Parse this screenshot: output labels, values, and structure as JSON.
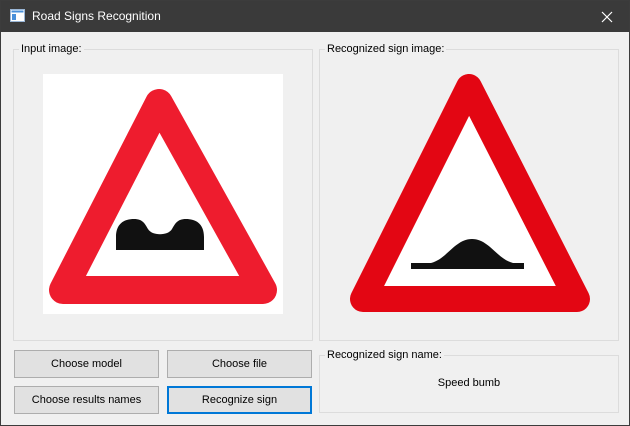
{
  "window": {
    "title": "Road Signs Recognition",
    "titlebar_color": "#3a3a3a",
    "app_icon": "window-app-icon",
    "close_icon": "close-icon"
  },
  "input_panel": {
    "label": "Input image:",
    "image": "warning-triangle-speed-bumps-sign"
  },
  "recognized_panel": {
    "label": "Recognized sign image:",
    "image": "warning-triangle-speed-bump-sign"
  },
  "buttons": {
    "choose_model": "Choose model",
    "choose_file": "Choose file",
    "choose_results_names": "Choose results names",
    "recognize_sign": "Recognize sign",
    "focus_color": "#0078d7"
  },
  "result_panel": {
    "label": "Recognized sign name:",
    "value": "Speed bumb"
  },
  "sign_colors": {
    "input_red": "#ee1c2e",
    "recognized_red": "#e30613",
    "fill": "#ffffff",
    "symbol": "#111111"
  }
}
